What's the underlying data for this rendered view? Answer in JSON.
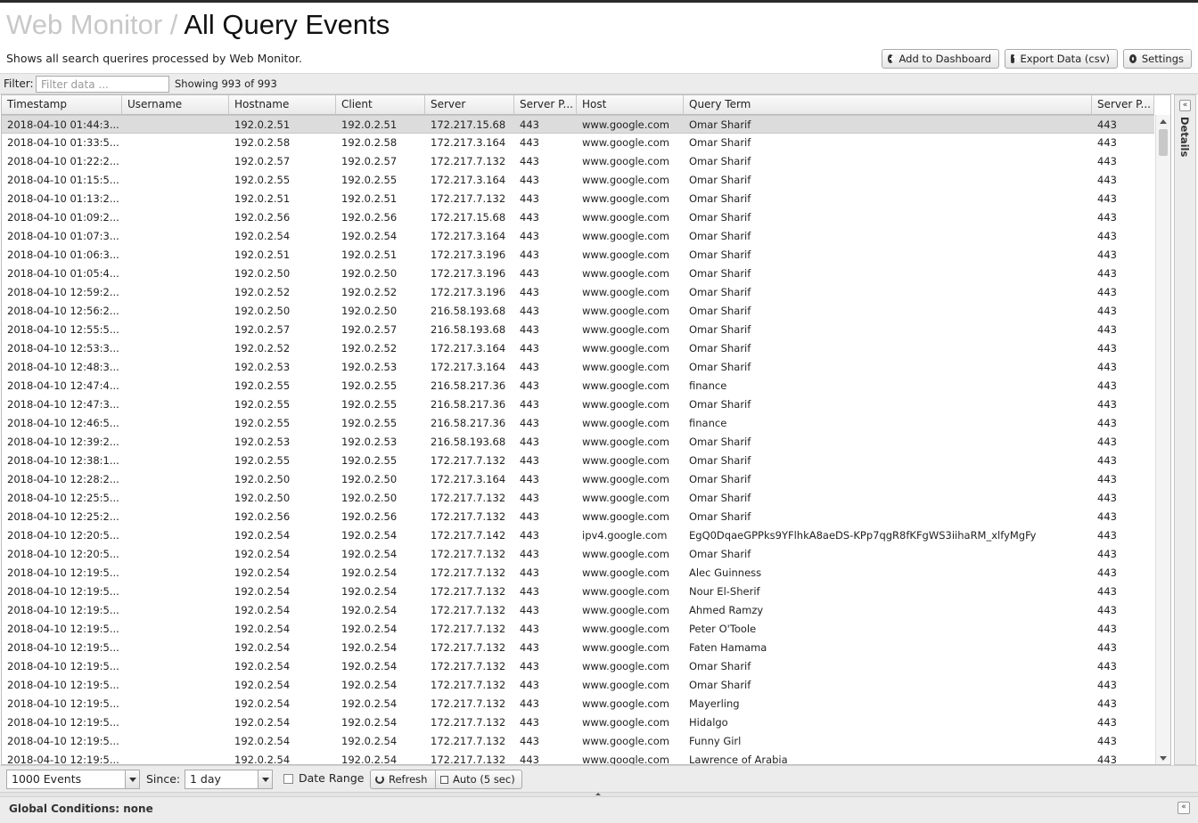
{
  "header": {
    "breadcrumb": "Web Monitor",
    "separator": "/",
    "title": "All Query Events",
    "subtitle": "Shows all search querires processed by Web Monitor.",
    "buttons": {
      "add_to_dashboard": "Add to Dashboard",
      "export": "Export Data (csv)",
      "settings": "Settings"
    }
  },
  "filter": {
    "label": "Filter:",
    "placeholder": "Filter data ...",
    "showing": "Showing 993 of 993"
  },
  "table": {
    "columns": [
      "Timestamp",
      "Username",
      "Hostname",
      "Client",
      "Server",
      "Server P...",
      "Host",
      "Query Term",
      "Server P..."
    ],
    "rows": [
      [
        "2018-04-10 01:44:3...",
        "",
        "192.0.2.51",
        "192.0.2.51",
        "172.217.15.68",
        "443",
        "www.google.com",
        "Omar Sharif",
        "443"
      ],
      [
        "2018-04-10 01:33:5...",
        "",
        "192.0.2.58",
        "192.0.2.58",
        "172.217.3.164",
        "443",
        "www.google.com",
        "Omar Sharif",
        "443"
      ],
      [
        "2018-04-10 01:22:2...",
        "",
        "192.0.2.57",
        "192.0.2.57",
        "172.217.7.132",
        "443",
        "www.google.com",
        "Omar Sharif",
        "443"
      ],
      [
        "2018-04-10 01:15:5...",
        "",
        "192.0.2.55",
        "192.0.2.55",
        "172.217.3.164",
        "443",
        "www.google.com",
        "Omar Sharif",
        "443"
      ],
      [
        "2018-04-10 01:13:2...",
        "",
        "192.0.2.51",
        "192.0.2.51",
        "172.217.7.132",
        "443",
        "www.google.com",
        "Omar Sharif",
        "443"
      ],
      [
        "2018-04-10 01:09:2...",
        "",
        "192.0.2.56",
        "192.0.2.56",
        "172.217.15.68",
        "443",
        "www.google.com",
        "Omar Sharif",
        "443"
      ],
      [
        "2018-04-10 01:07:3...",
        "",
        "192.0.2.54",
        "192.0.2.54",
        "172.217.3.164",
        "443",
        "www.google.com",
        "Omar Sharif",
        "443"
      ],
      [
        "2018-04-10 01:06:3...",
        "",
        "192.0.2.51",
        "192.0.2.51",
        "172.217.3.196",
        "443",
        "www.google.com",
        "Omar Sharif",
        "443"
      ],
      [
        "2018-04-10 01:05:4...",
        "",
        "192.0.2.50",
        "192.0.2.50",
        "172.217.3.196",
        "443",
        "www.google.com",
        "Omar Sharif",
        "443"
      ],
      [
        "2018-04-10 12:59:2...",
        "",
        "192.0.2.52",
        "192.0.2.52",
        "172.217.3.196",
        "443",
        "www.google.com",
        "Omar Sharif",
        "443"
      ],
      [
        "2018-04-10 12:56:2...",
        "",
        "192.0.2.50",
        "192.0.2.50",
        "216.58.193.68",
        "443",
        "www.google.com",
        "Omar Sharif",
        "443"
      ],
      [
        "2018-04-10 12:55:5...",
        "",
        "192.0.2.57",
        "192.0.2.57",
        "216.58.193.68",
        "443",
        "www.google.com",
        "Omar Sharif",
        "443"
      ],
      [
        "2018-04-10 12:53:3...",
        "",
        "192.0.2.52",
        "192.0.2.52",
        "172.217.3.164",
        "443",
        "www.google.com",
        "Omar Sharif",
        "443"
      ],
      [
        "2018-04-10 12:48:3...",
        "",
        "192.0.2.53",
        "192.0.2.53",
        "172.217.3.164",
        "443",
        "www.google.com",
        "Omar Sharif",
        "443"
      ],
      [
        "2018-04-10 12:47:4...",
        "",
        "192.0.2.55",
        "192.0.2.55",
        "216.58.217.36",
        "443",
        "www.google.com",
        "finance",
        "443"
      ],
      [
        "2018-04-10 12:47:3...",
        "",
        "192.0.2.55",
        "192.0.2.55",
        "216.58.217.36",
        "443",
        "www.google.com",
        "Omar Sharif",
        "443"
      ],
      [
        "2018-04-10 12:46:5...",
        "",
        "192.0.2.55",
        "192.0.2.55",
        "216.58.217.36",
        "443",
        "www.google.com",
        "finance",
        "443"
      ],
      [
        "2018-04-10 12:39:2...",
        "",
        "192.0.2.53",
        "192.0.2.53",
        "216.58.193.68",
        "443",
        "www.google.com",
        "Omar Sharif",
        "443"
      ],
      [
        "2018-04-10 12:38:1...",
        "",
        "192.0.2.55",
        "192.0.2.55",
        "172.217.7.132",
        "443",
        "www.google.com",
        "Omar Sharif",
        "443"
      ],
      [
        "2018-04-10 12:28:2...",
        "",
        "192.0.2.50",
        "192.0.2.50",
        "172.217.3.164",
        "443",
        "www.google.com",
        "Omar Sharif",
        "443"
      ],
      [
        "2018-04-10 12:25:5...",
        "",
        "192.0.2.50",
        "192.0.2.50",
        "172.217.7.132",
        "443",
        "www.google.com",
        "Omar Sharif",
        "443"
      ],
      [
        "2018-04-10 12:25:2...",
        "",
        "192.0.2.56",
        "192.0.2.56",
        "172.217.7.132",
        "443",
        "www.google.com",
        "Omar Sharif",
        "443"
      ],
      [
        "2018-04-10 12:20:5...",
        "",
        "192.0.2.54",
        "192.0.2.54",
        "172.217.7.142",
        "443",
        "ipv4.google.com",
        "EgQ0DqaeGPPks9YFlhkA8aeDS-KPp7qgR8fKFgWS3iihaRM_xlfyMgFy",
        "443"
      ],
      [
        "2018-04-10 12:20:5...",
        "",
        "192.0.2.54",
        "192.0.2.54",
        "172.217.7.132",
        "443",
        "www.google.com",
        "Omar Sharif",
        "443"
      ],
      [
        "2018-04-10 12:19:5...",
        "",
        "192.0.2.54",
        "192.0.2.54",
        "172.217.7.132",
        "443",
        "www.google.com",
        "Alec Guinness",
        "443"
      ],
      [
        "2018-04-10 12:19:5...",
        "",
        "192.0.2.54",
        "192.0.2.54",
        "172.217.7.132",
        "443",
        "www.google.com",
        "Nour El-Sherif",
        "443"
      ],
      [
        "2018-04-10 12:19:5...",
        "",
        "192.0.2.54",
        "192.0.2.54",
        "172.217.7.132",
        "443",
        "www.google.com",
        "Ahmed Ramzy",
        "443"
      ],
      [
        "2018-04-10 12:19:5...",
        "",
        "192.0.2.54",
        "192.0.2.54",
        "172.217.7.132",
        "443",
        "www.google.com",
        "Peter O'Toole",
        "443"
      ],
      [
        "2018-04-10 12:19:5...",
        "",
        "192.0.2.54",
        "192.0.2.54",
        "172.217.7.132",
        "443",
        "www.google.com",
        "Faten Hamama",
        "443"
      ],
      [
        "2018-04-10 12:19:5...",
        "",
        "192.0.2.54",
        "192.0.2.54",
        "172.217.7.132",
        "443",
        "www.google.com",
        "Omar Sharif",
        "443"
      ],
      [
        "2018-04-10 12:19:5...",
        "",
        "192.0.2.54",
        "192.0.2.54",
        "172.217.7.132",
        "443",
        "www.google.com",
        "Omar Sharif",
        "443"
      ],
      [
        "2018-04-10 12:19:5...",
        "",
        "192.0.2.54",
        "192.0.2.54",
        "172.217.7.132",
        "443",
        "www.google.com",
        "Mayerling",
        "443"
      ],
      [
        "2018-04-10 12:19:5...",
        "",
        "192.0.2.54",
        "192.0.2.54",
        "172.217.7.132",
        "443",
        "www.google.com",
        "Hidalgo",
        "443"
      ],
      [
        "2018-04-10 12:19:5...",
        "",
        "192.0.2.54",
        "192.0.2.54",
        "172.217.7.132",
        "443",
        "www.google.com",
        "Funny Girl",
        "443"
      ],
      [
        "2018-04-10 12:19:5...",
        "",
        "192.0.2.54",
        "192.0.2.54",
        "172.217.7.132",
        "443",
        "www.google.com",
        "Lawrence of Arabia",
        "443"
      ]
    ]
  },
  "details_panel": {
    "label": "Details",
    "collapse_glyph": "«"
  },
  "bottom": {
    "events_select": "1000 Events",
    "since_label": "Since:",
    "since_select": "1 day",
    "date_range_label": "Date Range",
    "refresh_label": "Refresh",
    "auto_label": "Auto (5 sec)"
  },
  "global_conditions": {
    "text": "Global Conditions: none",
    "expand_glyph": "«"
  },
  "colors": {
    "selected_row": "#dcdcdc",
    "toolbar_bg": "#ececec",
    "breadcrumb": "#c8c8c8"
  }
}
